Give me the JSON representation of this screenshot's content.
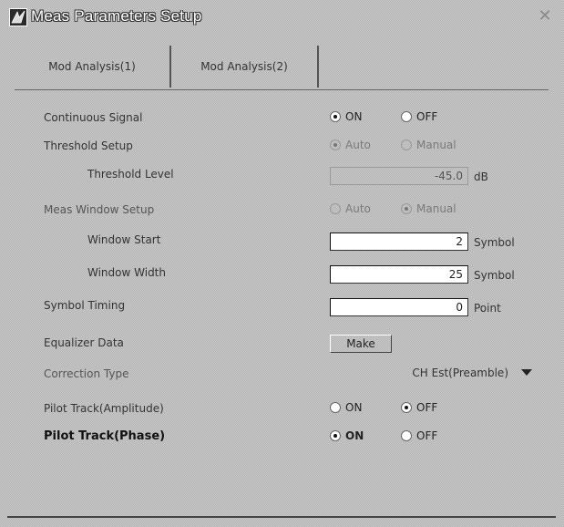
{
  "window": {
    "title": "Meas Parameters Setup"
  },
  "tabs": [
    {
      "label": "Mod Analysis(1)"
    },
    {
      "label": "Mod Analysis(2)"
    }
  ],
  "rows": {
    "continuous_signal": {
      "label": "Continuous Signal",
      "options": [
        "ON",
        "OFF"
      ],
      "selected": "ON"
    },
    "threshold_setup": {
      "label": "Threshold Setup",
      "options": [
        "Auto",
        "Manual"
      ],
      "selected": "Auto",
      "enabled": false
    },
    "threshold_level": {
      "label": "Threshold Level",
      "value": "-45.0",
      "unit": "dB",
      "enabled": false
    },
    "meas_window_setup": {
      "label": "Meas Window Setup",
      "options": [
        "Auto",
        "Manual"
      ],
      "selected": "Manual",
      "enabled": false
    },
    "window_start": {
      "label": "Window Start",
      "value": "2",
      "unit": "Symbol"
    },
    "window_width": {
      "label": "Window Width",
      "value": "25",
      "unit": "Symbol"
    },
    "symbol_timing": {
      "label": "Symbol Timing",
      "value": "0",
      "unit": "Point"
    },
    "equalizer_data": {
      "label": "Equalizer Data",
      "button": "Make"
    },
    "correction_type": {
      "label": "Correction Type",
      "value": "CH Est(Preamble)"
    },
    "pilot_track_amplitude": {
      "label": "Pilot Track(Amplitude)",
      "options": [
        "ON",
        "OFF"
      ],
      "selected": "OFF"
    },
    "pilot_track_phase": {
      "label": "Pilot Track(Phase)",
      "options": [
        "ON",
        "OFF"
      ],
      "selected": "ON"
    }
  }
}
